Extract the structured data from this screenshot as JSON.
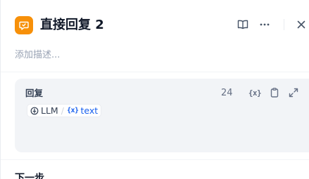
{
  "node": {
    "title": "直接回复 2",
    "description_placeholder": "添加描述...",
    "icon": "reply-bubble-icon",
    "accent_color": "#f79009"
  },
  "header_actions": {
    "help": "book-icon",
    "more": "more-icon",
    "close": "close-icon"
  },
  "answer_field": {
    "label": "回复",
    "char_count": "24",
    "actions": {
      "variable": "{x}",
      "copy": "clipboard-icon",
      "expand": "expand-icon"
    },
    "variable_chip": {
      "source": "LLM",
      "separator": "/",
      "var_mark": "{x}",
      "var_name": "text",
      "color": "#155eef"
    }
  },
  "next_step": {
    "label": "下一步"
  }
}
